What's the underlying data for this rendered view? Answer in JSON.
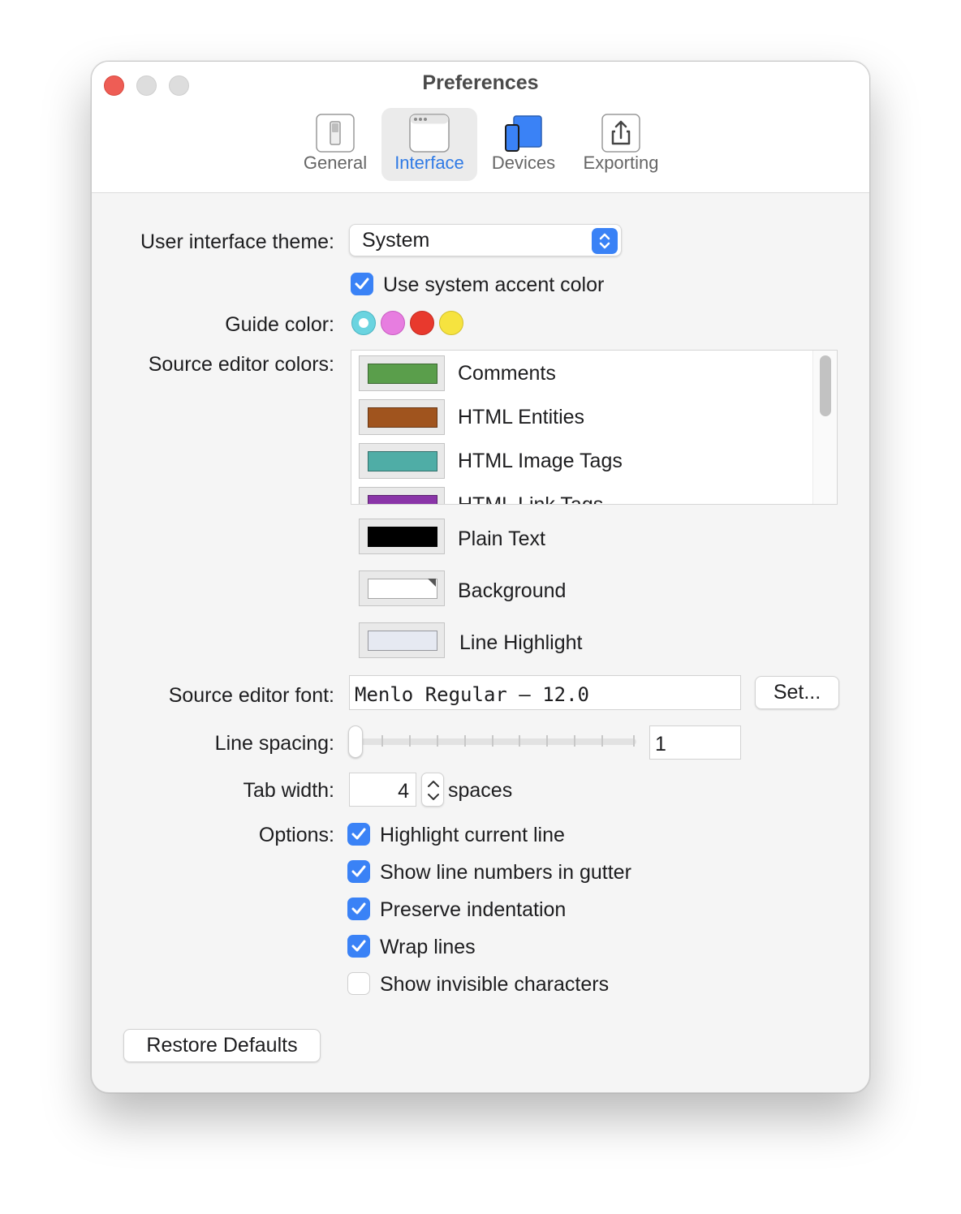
{
  "window": {
    "title": "Preferences"
  },
  "toolbar": {
    "tabs": [
      {
        "label": "General",
        "icon": "switch-icon",
        "selected": false
      },
      {
        "label": "Interface",
        "icon": "window-icon",
        "selected": true
      },
      {
        "label": "Devices",
        "icon": "devices-icon",
        "selected": false
      },
      {
        "label": "Exporting",
        "icon": "share-icon",
        "selected": false
      }
    ]
  },
  "theme": {
    "label": "User interface theme:",
    "value": "System"
  },
  "accent": {
    "label": "Use system accent color",
    "checked": true
  },
  "guide": {
    "label": "Guide color:",
    "colors": [
      "#6ad4e0",
      "#e77de0",
      "#e8392d",
      "#f6e33f"
    ],
    "selected_index": 0
  },
  "source_colors": {
    "label": "Source editor colors:",
    "list_items": [
      {
        "name": "Comments",
        "color": "#5a9e4b"
      },
      {
        "name": "HTML Entities",
        "color": "#a0541e"
      },
      {
        "name": "HTML Image Tags",
        "color": "#4fada6"
      },
      {
        "name": "HTML Link Tags",
        "color": "#8a35a8"
      }
    ],
    "extra_items": [
      {
        "name": "Plain Text",
        "color": "#000000"
      },
      {
        "name": "Background",
        "color": "#ffffff"
      },
      {
        "name": "Line Highlight",
        "color": "#e6e9f2"
      }
    ]
  },
  "font": {
    "label": "Source editor font:",
    "value": "Menlo Regular – 12.0",
    "set_button": "Set..."
  },
  "line_spacing": {
    "label": "Line spacing:",
    "value": "1",
    "slider_level": 0
  },
  "tab_width": {
    "label": "Tab width:",
    "value": "4",
    "unit": "spaces"
  },
  "options": {
    "label": "Options:",
    "items": [
      {
        "label": "Highlight current line",
        "checked": true
      },
      {
        "label": "Show line numbers in gutter",
        "checked": true
      },
      {
        "label": "Preserve indentation",
        "checked": true
      },
      {
        "label": "Wrap lines",
        "checked": true
      },
      {
        "label": "Show invisible characters",
        "checked": false
      }
    ]
  },
  "restore_button": "Restore Defaults"
}
